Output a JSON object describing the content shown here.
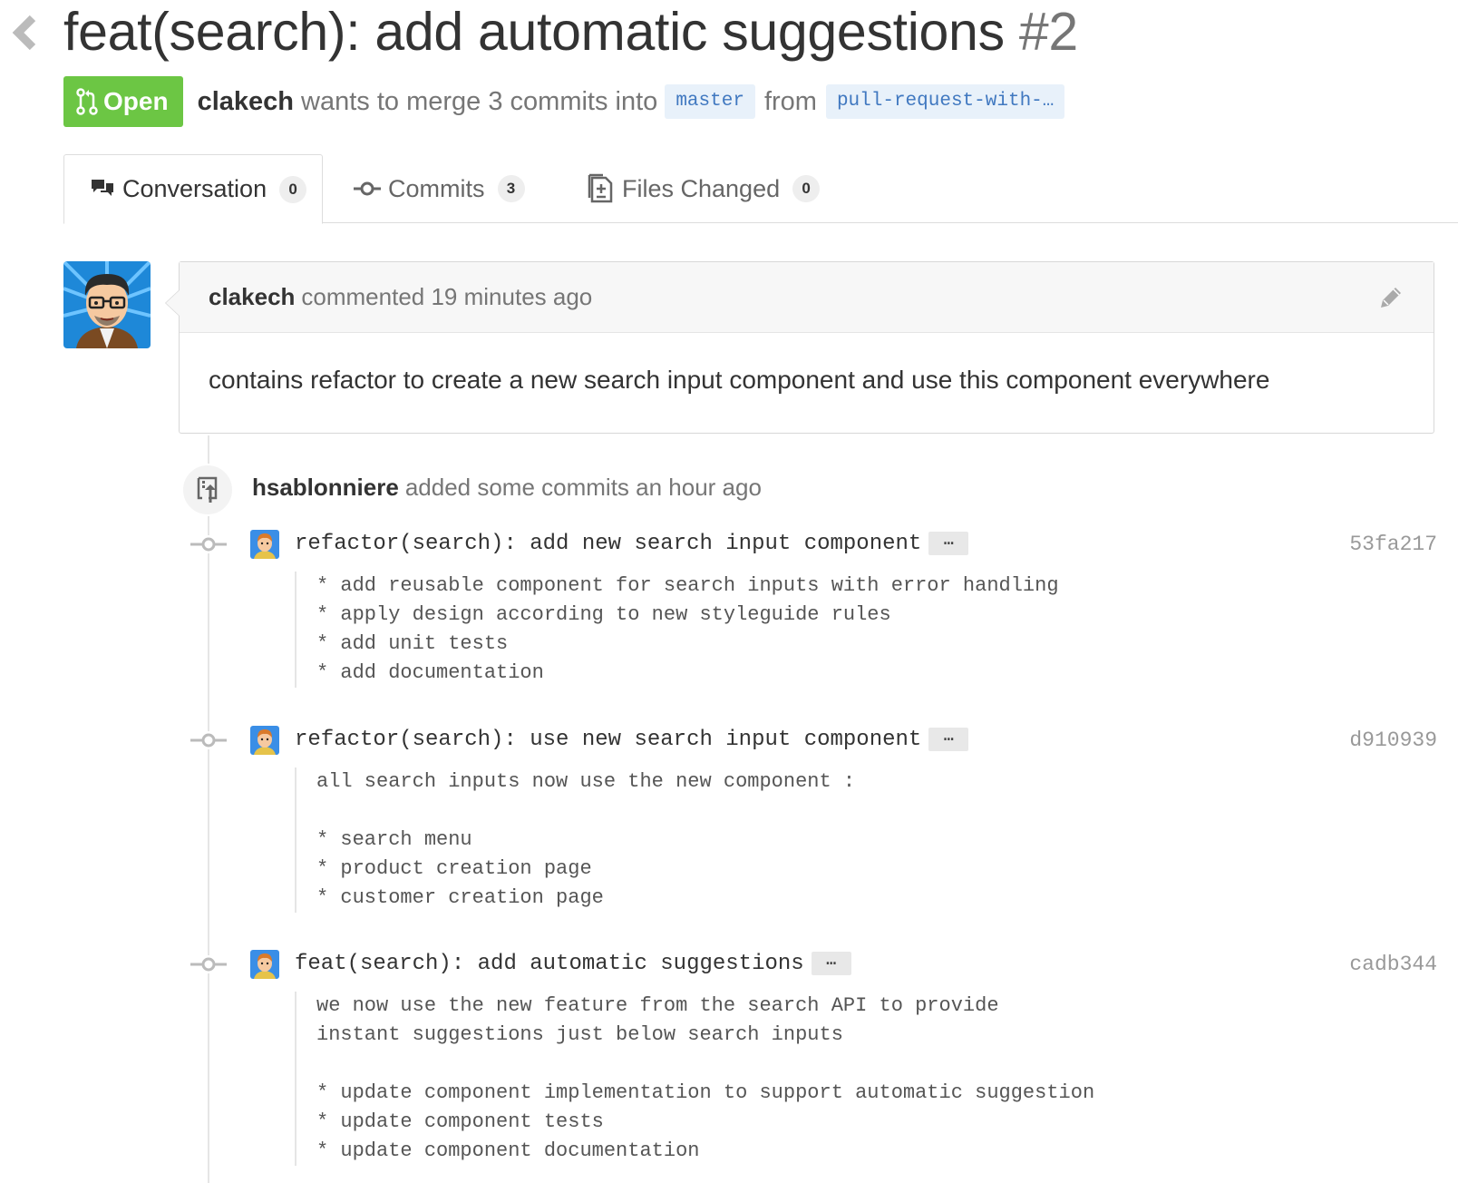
{
  "pr": {
    "title": "feat(search): add automatic suggestions",
    "number": "#2",
    "state": "Open",
    "author": "clakech",
    "merge_text": "wants to merge 3 commits into",
    "base_branch": "master",
    "from_text": "from",
    "head_branch": "pull-request-with-…"
  },
  "tabs": [
    {
      "label": "Conversation",
      "count": "0"
    },
    {
      "label": "Commits",
      "count": "3"
    },
    {
      "label": "Files Changed",
      "count": "0"
    }
  ],
  "comment": {
    "author": "clakech",
    "meta": "commented 19 minutes ago",
    "body": "contains refactor to create a new search input component and use this component everywhere"
  },
  "event": {
    "author": "hsablonniere",
    "text": "added some commits an hour ago"
  },
  "commits": [
    {
      "message": "refactor(search): add new search input component",
      "ellipsis": "…",
      "sha": "53fa217",
      "description": "* add reusable component for search inputs with error handling\n* apply design according to new styleguide rules\n* add unit tests\n* add documentation"
    },
    {
      "message": "refactor(search): use new search input component",
      "ellipsis": "…",
      "sha": "d910939",
      "description": "all search inputs now use the new component :\n\n* search menu\n* product creation page\n* customer creation page"
    },
    {
      "message": "feat(search): add automatic suggestions",
      "ellipsis": "…",
      "sha": "cadb344",
      "description": "we now use the new feature from the search API to provide\ninstant suggestions just below search inputs\n\n* update component implementation to support automatic suggestion\n* update component tests\n* update component documentation"
    }
  ],
  "colors": {
    "open_green": "#6cc644",
    "branch_bg": "#e8f1fa",
    "branch_text": "#4078c0",
    "muted_text": "#767676"
  }
}
